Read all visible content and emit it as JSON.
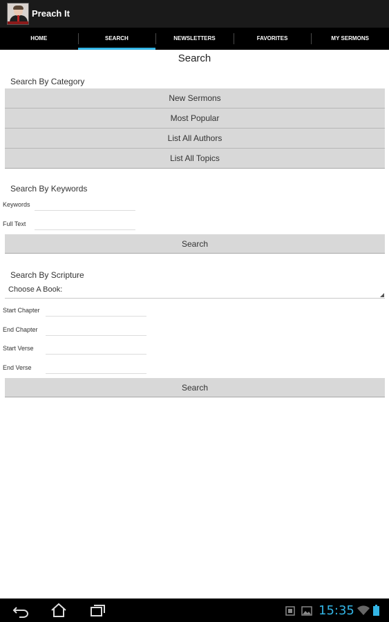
{
  "app": {
    "title": "Preach It"
  },
  "tabs": [
    {
      "label": "HOME"
    },
    {
      "label": "SEARCH"
    },
    {
      "label": "NEWSLETTERS"
    },
    {
      "label": "FAVORITES"
    },
    {
      "label": "MY SERMONS"
    }
  ],
  "active_tab": "SEARCH",
  "page": {
    "title": "Search"
  },
  "category": {
    "label": "Search By Category",
    "buttons": [
      "New Sermons",
      "Most Popular",
      "List All Authors",
      "List All Topics"
    ]
  },
  "keywords": {
    "label": "Search By Keywords",
    "keyword_label": "Keywords",
    "keyword_value": "",
    "fulltext_label": "Full Text",
    "fulltext_value": "",
    "search_label": "Search"
  },
  "scripture": {
    "label": "Search By Scripture",
    "book_select": "Choose A Book:",
    "start_chapter_label": "Start Chapter",
    "end_chapter_label": "End Chapter",
    "start_verse_label": "Start Verse",
    "end_verse_label": "End Verse",
    "search_label": "Search"
  },
  "status": {
    "time": "15:35"
  },
  "colors": {
    "accent": "#33b5e5",
    "button_bg": "#d8d8d8",
    "bar_bg": "#000000"
  },
  "icons": [
    "back-icon",
    "home-icon",
    "recent-apps-icon",
    "screenshot-notify-icon",
    "gallery-notify-icon",
    "wifi-icon",
    "battery-icon"
  ]
}
